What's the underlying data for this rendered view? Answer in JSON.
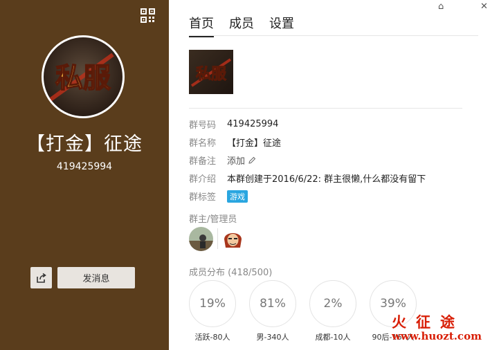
{
  "left_panel": {
    "group_name": "【打金】征途",
    "group_number": "419425994",
    "send_message_label": "发消息",
    "avatar_text": "私服",
    "background_color": "#5a3d1c"
  },
  "tabs": [
    {
      "label": "首页",
      "active": true
    },
    {
      "label": "成员",
      "active": false
    },
    {
      "label": "设置",
      "active": false
    }
  ],
  "window_controls": {
    "skin": "⌂",
    "close": "✕"
  },
  "thumbnail_text": "私服",
  "info": {
    "number": {
      "label": "群号码",
      "value": "419425994"
    },
    "name": {
      "label": "群名称",
      "value": "【打金】征途"
    },
    "remark": {
      "label": "群备注",
      "value": "添加"
    },
    "intro": {
      "label": "群介绍",
      "value": "本群创建于2016/6/22:  群主很懒,什么都没有留下"
    },
    "tags": {
      "label": "群标签",
      "value": "游戏"
    }
  },
  "admins_title": "群主/管理员",
  "members_title": "成员分布",
  "members_count": "(418/500)",
  "stats": [
    {
      "percent": "19%",
      "label": "活跃-80人"
    },
    {
      "percent": "81%",
      "label": "男-340人"
    },
    {
      "percent": "2%",
      "label": "成都-10人"
    },
    {
      "percent": "39%",
      "label": "90后-167人"
    }
  ],
  "watermark": {
    "top": "火征途",
    "bottom": "www.huozt.com"
  },
  "colors": {
    "tag": "#2aa6e0",
    "watermark": "#d81e06"
  }
}
